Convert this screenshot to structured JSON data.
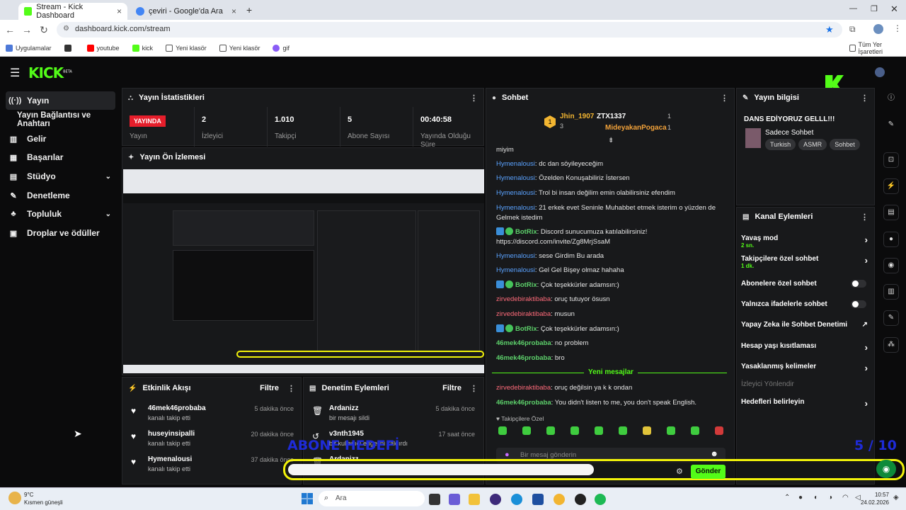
{
  "browser": {
    "tabs": [
      {
        "label": "Stream - Kick Dashboard",
        "active": true
      },
      {
        "label": "çeviri - Google'da Ara",
        "active": false
      }
    ],
    "new_tab": "+",
    "url": "dashboard.kick.com/stream",
    "bookmarks": [
      "Uygulamalar",
      "youtube",
      "kick",
      "Yeni klasör",
      "Yeni klasör",
      "gif"
    ],
    "all_bookmarks": "Tüm Yer İşaretleri"
  },
  "kick": {
    "logo": "KICK",
    "beta": "BETA"
  },
  "sidebar": {
    "items": [
      {
        "label": "Yayın",
        "icon": "broadcast-icon"
      },
      {
        "label": "Yayın Bağlantısı ve Anahtarı",
        "icon": ""
      },
      {
        "label": "Gelir",
        "icon": "chart-icon"
      },
      {
        "label": "Başarılar",
        "icon": "trophy-icon"
      },
      {
        "label": "Stüdyo",
        "icon": "studio-icon"
      },
      {
        "label": "Denetleme",
        "icon": "wrench-icon"
      },
      {
        "label": "Topluluk",
        "icon": "community-icon"
      },
      {
        "label": "Droplar ve ödüller",
        "icon": "gift-icon"
      }
    ]
  },
  "stats": {
    "title": "Yayın İstatistikleri",
    "live_badge": "YAYINDA",
    "items": [
      {
        "value": "",
        "label": "Yayın"
      },
      {
        "value": "2",
        "label": "İzleyici"
      },
      {
        "value": "1.010",
        "label": "Takipçi"
      },
      {
        "value": "5",
        "label": "Abone Sayısı"
      },
      {
        "value": "00:40:58",
        "label": "Yayında Olduğu Süre"
      }
    ]
  },
  "preview": {
    "title": "Yayın Ön İzlemesi"
  },
  "activity": {
    "title": "Etkinlik Akışı",
    "filter": "Filtre",
    "items": [
      {
        "name": "46mek46probaba",
        "action": "kanalı takip etti",
        "time": "5 dakika önce"
      },
      {
        "name": "huseyinsipalli",
        "action": "kanalı takip etti",
        "time": "20 dakika önce"
      },
      {
        "name": "Hymenalousi",
        "action": "kanalı takip etti",
        "time": "37 dakika önce"
      }
    ]
  },
  "moderation": {
    "title": "Denetim Eylemleri",
    "filter": "Filtre",
    "items": [
      {
        "name": "Ardanizz",
        "action": "bir mesajı sildi",
        "time": "5 dakika önce"
      },
      {
        "name": "v3nth1945",
        "action": "bir kullanıcı engelini kaldırdı",
        "time": "17 saat önce"
      },
      {
        "name": "Ardanizz",
        "action": "",
        "time": ""
      }
    ]
  },
  "chat": {
    "title": "Sohbet",
    "top": [
      {
        "name": "Jhin_1907",
        "count": "3"
      },
      {
        "name": "ZTX1337",
        "count": "1"
      },
      {
        "name": "MideyakanPogaca",
        "count": "1"
      }
    ],
    "messages": [
      {
        "user": "",
        "text": "miyim",
        "cls": ""
      },
      {
        "user": "Hymenalousi",
        "text": ": dc dan söyileyeceğim",
        "cls": "u1"
      },
      {
        "user": "Hymenalousi",
        "text": ": Özelden Konuşabiliriz İstersen",
        "cls": "u1"
      },
      {
        "user": "Hymenalousi",
        "text": ": Trol bi insan değilim emin olabilirsiniz efendim",
        "cls": "u1"
      },
      {
        "user": "Hymenalousi",
        "text": ": 21 erkek evet Seninle Muhabbet etmek isterim o yüzden de Gelmek istedim",
        "cls": "u1"
      },
      {
        "user": "BotRix",
        "text": ": Discord sunucumuza katılabilirsiniz! https://discord.com/invite/Zg8MrjSsaM",
        "cls": "bot"
      },
      {
        "user": "Hymenalousi",
        "text": ": sese Girdim Bu arada",
        "cls": "u1"
      },
      {
        "user": "Hymenalousi",
        "text": ": Gel Gel Bişey olmaz hahaha",
        "cls": "u1"
      },
      {
        "user": "BotRix",
        "text": ": Çok teşekkürler adamsın:)",
        "cls": "bot"
      },
      {
        "user": "zirvedebiraktibaba",
        "text": ": oruç tutuyor ösusn",
        "cls": "u2"
      },
      {
        "user": "zirvedebiraktibaba",
        "text": ": musun",
        "cls": "u2"
      },
      {
        "user": "BotRix",
        "text": ": Çok teşekkürler adamsın:)",
        "cls": "bot"
      },
      {
        "user": "46mek46probaba",
        "text": ": no problem",
        "cls": "u3"
      },
      {
        "user": "46mek46probaba",
        "text": ": bro",
        "cls": "u3"
      },
      {
        "user": "zirvedebiraktibaba",
        "text": ": oruç değilsin ya k k ondan",
        "cls": "u2"
      },
      {
        "user": "46mek46probaba",
        "text": ": You didn't listen to me, you don't speak English.",
        "cls": "u3"
      }
    ],
    "new_messages": "Yeni mesajlar",
    "followers_only": "Takipçilere Özel",
    "input_placeholder": "Bir mesaj gönderin",
    "send": "Gönder"
  },
  "stream_info": {
    "title": "Yayın bilgisi",
    "stream_title": "DANS EDİYORUZ GELLL!!!",
    "category": "Sadece Sohbet",
    "tags": [
      "Turkish",
      "ASMR",
      "Sohbet"
    ]
  },
  "channel_actions": {
    "title": "Kanal Eylemleri",
    "items": [
      {
        "label": "Yavaş mod",
        "sub": "2 sn.",
        "ctrl": "chevron"
      },
      {
        "label": "Takipçilere özel sohbet",
        "sub": "1 dk.",
        "ctrl": "chevron"
      },
      {
        "label": "Abonelere özel sohbet",
        "sub": "",
        "ctrl": "toggle"
      },
      {
        "label": "Yalnızca ifadelerle sohbet",
        "sub": "",
        "ctrl": "toggle"
      },
      {
        "label": "Yapay Zeka ile Sohbet Denetimi",
        "sub": "",
        "ctrl": "external"
      },
      {
        "label": "Hesap yaşı kısıtlaması",
        "sub": "",
        "ctrl": "chevron"
      },
      {
        "label": "Yasaklanmış kelimeler",
        "sub": "",
        "ctrl": "chevron"
      },
      {
        "label": "İzleyici Yönlendir",
        "sub": "",
        "ctrl": "none"
      },
      {
        "label": "Hedefleri belirleyin",
        "sub": "",
        "ctrl": "chevron"
      }
    ]
  },
  "overlay": {
    "goal_text": "ABONE HEDEFİ",
    "goal_count": "5 / 10"
  },
  "taskbar": {
    "weather_temp": "9°C",
    "weather_desc": "Kısmen güneşli",
    "search": "Ara",
    "time": "10:57",
    "date": "24.02.2026"
  },
  "colors": {
    "accent": "#53fc18",
    "live": "#e61e2b",
    "panel": "#18191b"
  }
}
